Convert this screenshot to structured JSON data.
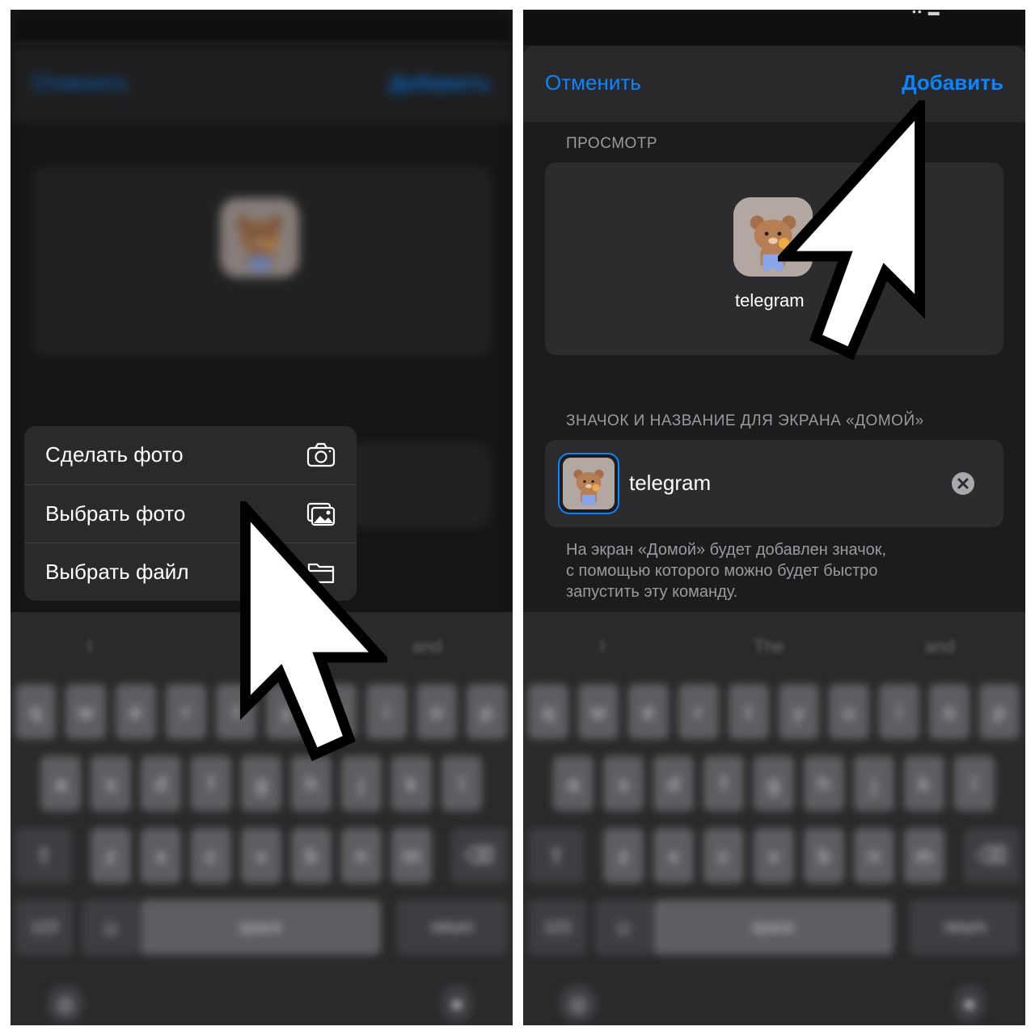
{
  "left_screen": {
    "menu": {
      "items": [
        {
          "label": "Сделать фото",
          "icon": "camera-icon"
        },
        {
          "label": "Выбрать фото",
          "icon": "photos-icon"
        },
        {
          "label": "Выбрать файл",
          "icon": "folder-icon"
        }
      ]
    },
    "cursor_icon": "pixel-arrow-cursor-icon"
  },
  "right_screen": {
    "navbar": {
      "cancel_label": "Отменить",
      "add_label": "Добавить"
    },
    "preview": {
      "section_label": "ПРОСМОТР",
      "app_name": "telegram",
      "icon": "bear-app-icon"
    },
    "home_section": {
      "section_label": "ЗНАЧОК И НАЗВАНИЕ ДЛЯ ЭКРАНА «ДОМОЙ»",
      "name_value": "telegram",
      "note_line1": "На экран «Домой» будет добавлен значок,",
      "note_line2": "с помощью которого можно будет быстро",
      "note_line3": "запустить эту команду."
    },
    "cursor_icon": "pixel-arrow-cursor-icon"
  },
  "keyboard": {
    "suggestions": [
      "I",
      "The",
      "and"
    ],
    "row1": [
      "q",
      "w",
      "e",
      "r",
      "t",
      "y",
      "u",
      "i",
      "o",
      "p"
    ],
    "row2": [
      "a",
      "s",
      "d",
      "f",
      "g",
      "h",
      "j",
      "k",
      "l"
    ],
    "row3": [
      "z",
      "x",
      "c",
      "v",
      "b",
      "n",
      "m"
    ],
    "numbers_label": "123",
    "space_label": "space",
    "return_label": "return"
  },
  "colors": {
    "accent": "#0a84ff",
    "background": "#1c1c1e",
    "card": "#2c2c2e"
  }
}
